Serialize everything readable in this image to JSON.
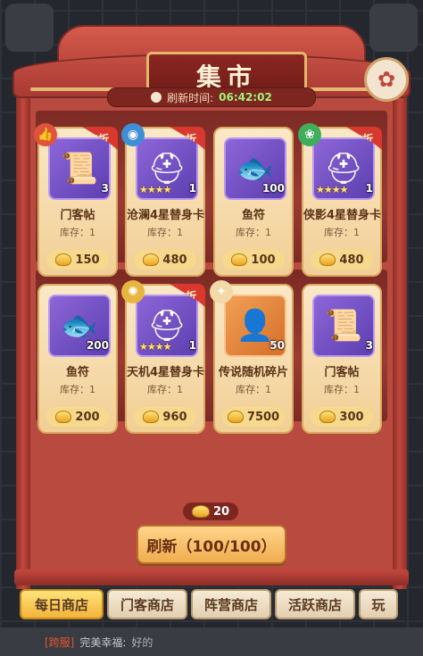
{
  "title": "集市",
  "refresh": {
    "label": "刷新时间:",
    "time": "06:42:02"
  },
  "items": [
    {
      "name": "门客帖",
      "stock": "库存：1",
      "price": "150",
      "qty": "3",
      "badge": "5折",
      "stars": "",
      "tag": "thumbs-up",
      "icon": "scroll-icon"
    },
    {
      "name": "沧澜4星替身卡",
      "stock": "库存：1",
      "price": "480",
      "qty": "1",
      "badge": "8折",
      "stars": "★★★★",
      "tag": "water",
      "icon": "helmet-icon"
    },
    {
      "name": "鱼符",
      "stock": "库存：1",
      "price": "100",
      "qty": "100",
      "badge": "",
      "stars": "",
      "tag": "",
      "icon": "fish-token-icon"
    },
    {
      "name": "侠影4星替身卡",
      "stock": "库存：1",
      "price": "480",
      "qty": "1",
      "badge": "8折",
      "stars": "★★★★",
      "tag": "wind",
      "icon": "helmet-icon"
    },
    {
      "name": "鱼符",
      "stock": "库存：1",
      "price": "200",
      "qty": "200",
      "badge": "",
      "stars": "",
      "tag": "",
      "icon": "fish-token-icon"
    },
    {
      "name": "天机4星替身卡",
      "stock": "库存：1",
      "price": "960",
      "qty": "1",
      "badge": "8折",
      "stars": "★★★★",
      "tag": "gear",
      "icon": "helmet-icon"
    },
    {
      "name": "传说随机碎片",
      "stock": "库存：1",
      "price": "7500",
      "qty": "50",
      "badge": "",
      "stars": "",
      "tag": "puzzle",
      "icon": "silhouette-icon"
    },
    {
      "name": "门客帖",
      "stock": "库存：1",
      "price": "300",
      "qty": "3",
      "badge": "",
      "stars": "",
      "tag": "",
      "icon": "scroll-icon"
    }
  ],
  "refresh_cost": "20",
  "refresh_button": "刷新（100/100）",
  "tabs": [
    "每日商店",
    "门客商店",
    "阵营商店",
    "活跃商店",
    "玩"
  ],
  "chat": {
    "channel": "[跨服]",
    "name": "完美幸福:",
    "message": "好的"
  },
  "colors": {
    "accent": "#b84a3f",
    "gold": "#f0ad4f",
    "timer": "#9ef57a"
  }
}
